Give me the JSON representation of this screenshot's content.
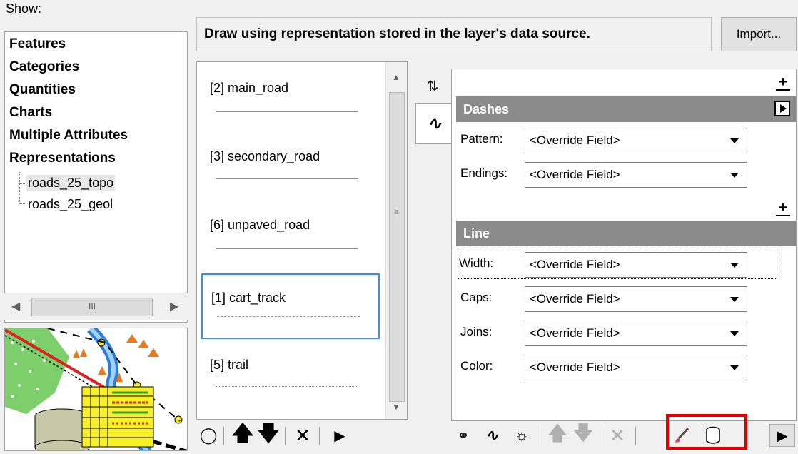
{
  "show": {
    "label": "Show:",
    "tree": [
      {
        "label": "Features"
      },
      {
        "label": "Categories"
      },
      {
        "label": "Quantities"
      },
      {
        "label": "Charts"
      },
      {
        "label": "Multiple Attributes"
      },
      {
        "label": "Representations"
      }
    ],
    "children": [
      {
        "label": "roads_25_topo",
        "selected": true
      },
      {
        "label": "roads_25_geol",
        "selected": false
      }
    ]
  },
  "header": {
    "description": "Draw using representation stored in the layer's data source.",
    "import_label": "Import..."
  },
  "rules": [
    {
      "label": "[2] main_road",
      "style": "solid"
    },
    {
      "label": "[3] secondary_road",
      "style": "solid"
    },
    {
      "label": "[6] unpaved_road",
      "style": "solid"
    },
    {
      "label": "[1] cart_track",
      "style": "dashed",
      "selected": true
    },
    {
      "label": "[5] trail",
      "style": "dotted"
    }
  ],
  "scrollbar_thumb_label": "III",
  "sections": {
    "dashes": {
      "title": "Dashes",
      "rows": [
        {
          "label": "Pattern:",
          "value": "<Override Field>"
        },
        {
          "label": "Endings:",
          "value": "<Override Field>"
        }
      ]
    },
    "line": {
      "title": "Line",
      "rows": [
        {
          "label": "Width:",
          "value": "<Override Field>"
        },
        {
          "label": "Caps:",
          "value": "<Override Field>"
        },
        {
          "label": "Joins:",
          "value": "<Override Field>"
        },
        {
          "label": "Color:",
          "value": "<Override Field>"
        }
      ]
    }
  },
  "icons": {
    "rule_toolbar": [
      "add-rule-icon",
      "move-up-icon",
      "move-down-icon",
      "delete-icon",
      "menu-arrow-icon"
    ],
    "prop_toolbar": [
      "add-geometric-effect-icon",
      "add-layer-icon",
      "add-marker-icon",
      "move-up-icon",
      "move-down-icon",
      "delete-icon",
      "paintbrush-icon",
      "database-icon",
      "menu-arrow-icon"
    ]
  },
  "colors": {
    "highlight": "#e00000",
    "selection": "#3a8ee6",
    "section_header": "#8a8a8a"
  }
}
